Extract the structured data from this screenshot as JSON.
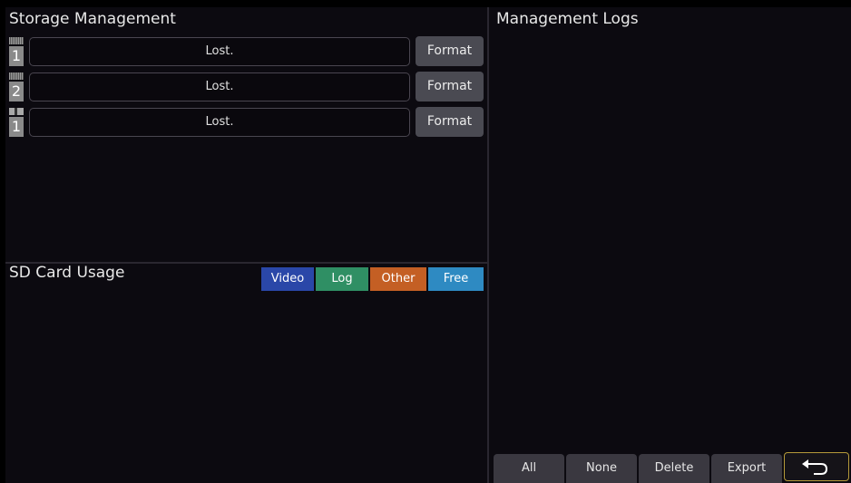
{
  "storage": {
    "title": "Storage Management",
    "rows": [
      {
        "slot_number": "1",
        "slot_icon": "sd-card-icon",
        "status": "Lost.",
        "format_label": "Format"
      },
      {
        "slot_number": "2",
        "slot_icon": "sd-card-icon",
        "status": "Lost.",
        "format_label": "Format"
      },
      {
        "slot_number": "1",
        "slot_icon": "usb-drive-icon",
        "status": "Lost.",
        "format_label": "Format"
      }
    ]
  },
  "usage": {
    "title": "SD Card Usage",
    "legend": [
      {
        "label": "Video",
        "color": "#2a47a8"
      },
      {
        "label": "Log",
        "color": "#2f8f64"
      },
      {
        "label": "Other",
        "color": "#c45f24"
      },
      {
        "label": "Free",
        "color": "#2e8ac2"
      }
    ]
  },
  "logs": {
    "title": "Management Logs",
    "buttons": {
      "all": "All",
      "none": "None",
      "delete": "Delete",
      "export": "Export"
    },
    "back_icon": "back-arrow-icon"
  },
  "colors": {
    "accent_border": "#b59a3a",
    "button_bg": "#4a4a52",
    "panel_bg": "#0c0a10"
  }
}
